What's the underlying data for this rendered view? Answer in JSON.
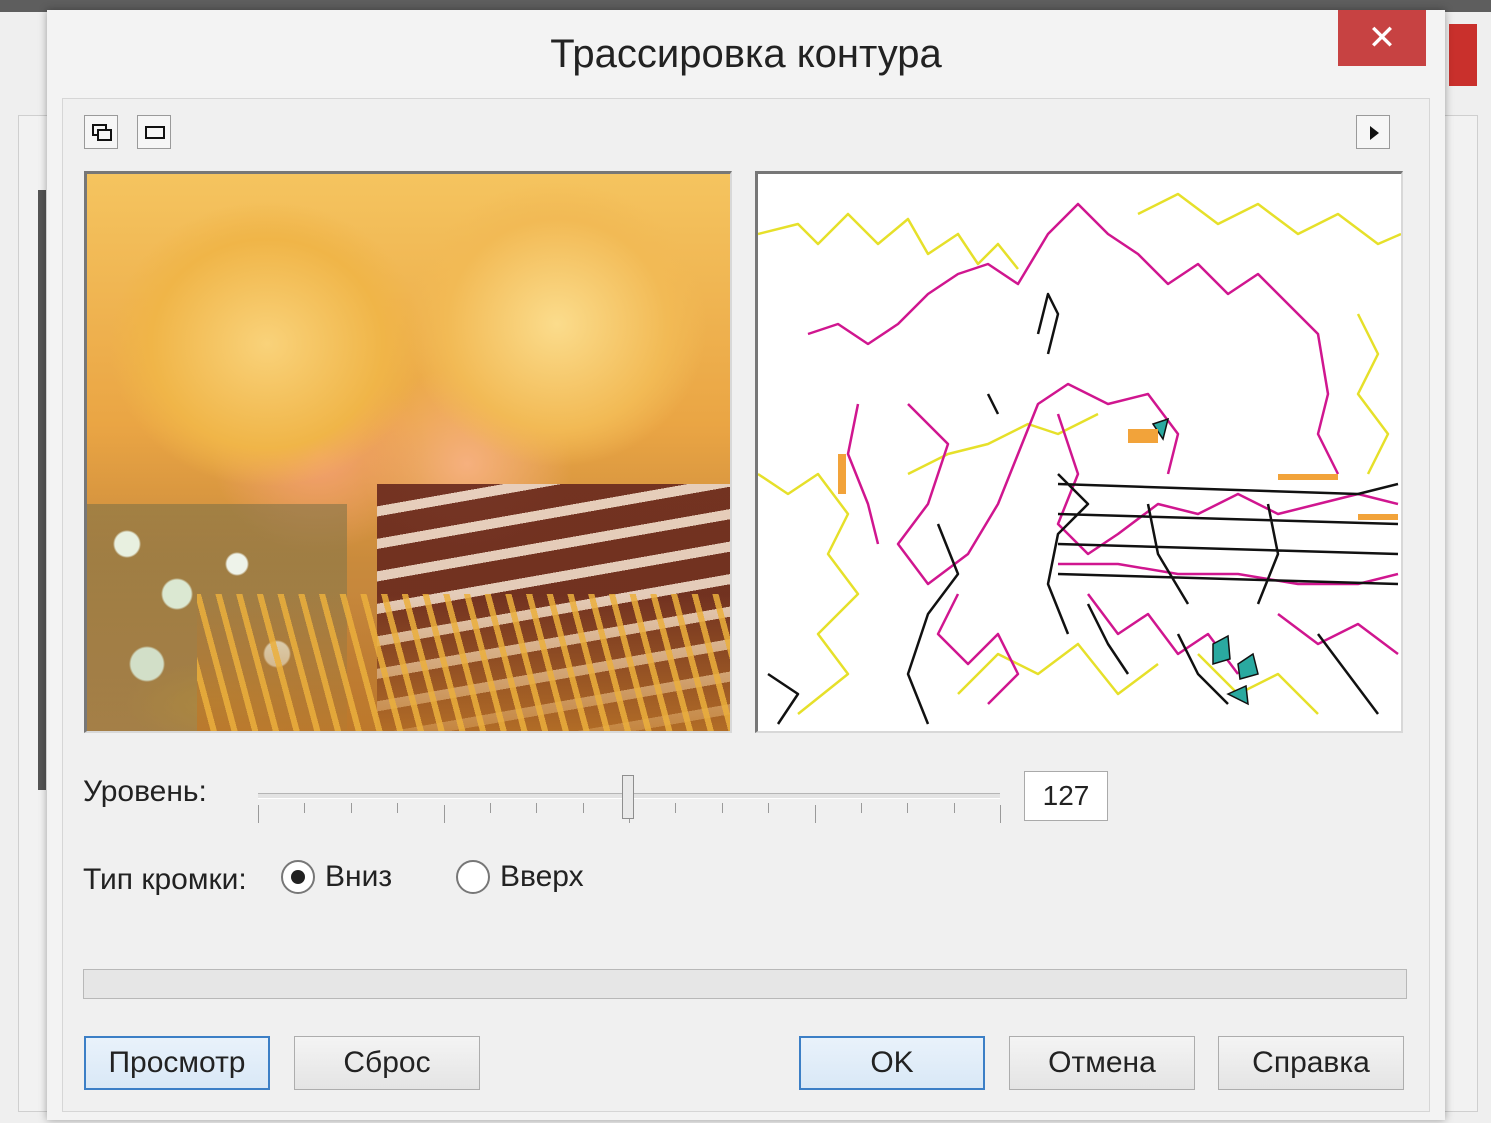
{
  "dialog": {
    "title": "Трассировка контура",
    "close_glyph": "✕"
  },
  "toolbar": {
    "icons": [
      "split-view-icon",
      "single-view-icon",
      "expand-arrow-icon"
    ]
  },
  "level": {
    "label": "Уровень:",
    "value": "127",
    "min": 0,
    "max": 255
  },
  "edge_type": {
    "label": "Тип кромки:",
    "options": [
      {
        "label": "Вниз",
        "checked": true
      },
      {
        "label": "Вверх",
        "checked": false
      }
    ]
  },
  "buttons": {
    "preview": "Просмотр",
    "reset": "Сброс",
    "ok": "OK",
    "cancel": "Отмена",
    "help": "Справка"
  },
  "colors": {
    "close_button": "#c74242",
    "default_button_border": "#3c7fc6",
    "contour_magenta": "#d0168f",
    "contour_yellow": "#e6e02a",
    "contour_black": "#111111"
  }
}
